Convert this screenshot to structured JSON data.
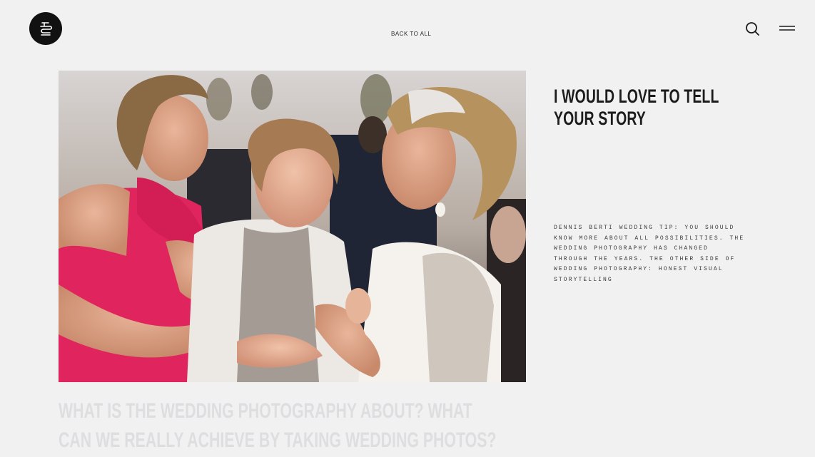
{
  "header": {
    "back_label": "BACK TO ALL",
    "logo_icon": "monogram-logo-icon",
    "search_icon": "search-icon",
    "menu_icon": "hamburger-menu-icon"
  },
  "hero": {
    "photo_description_icon": "wedding-photo"
  },
  "sidebar": {
    "headline": "I WOULD LOVE TO TELL YOUR STORY",
    "tip": "DENNIS BERTI WEDDING TIP: YOU SHOULD KNOW MORE ABOUT ALL POSSIBILITIES. THE WEDDING PHOTOGRAPHY HAS CHANGED THROUGH THE YEARS. THE OTHER SIDE OF WEDDING PHOTOGRAPHY: HONEST VISUAL STORYTELLING"
  },
  "article": {
    "heading": "WHAT IS THE WEDDING PHOTOGRAPHY ABOUT? WHAT CAN WE REALLY ACHIEVE BY TAKING WEDDING PHOTOS?"
  },
  "colors": {
    "background": "#f1f1f2",
    "logo_bg": "#111111",
    "headline": "#1c1c1c",
    "faded_heading": "#dedee0",
    "dress_pink": "#e0245e"
  }
}
